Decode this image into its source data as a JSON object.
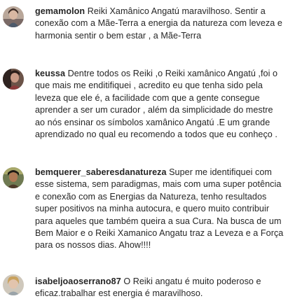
{
  "comments": [
    {
      "username": "gemamolon",
      "text": "Reiki Xamânico Angatú maravilhoso. Sentir a conexão com a Mãe-Terra a energia da natureza com leveza e harmonia sentir o bem estar , a Mãe-Terra"
    },
    {
      "username": "keussa",
      "text": "Dentre todos os Reiki ,o Reiki xamânico Angatú ,foi o que mais me enditifiquei , acredito eu que tenha sido pela leveza que ele é, a facilidade com que a gente consegue aprender a ser um curador , além da simplicidade do mestre ao nós ensinar os símbolos xamânico Angatú .E um grande aprendizado no qual eu recomendo a todos que eu conheço ."
    },
    {
      "username": "bemquerer_saberesdanatureza",
      "text": "Super me identifiquei com esse sistema, sem paradigmas, mais com uma super potência e conexão com as Energias da Natureza, tenho resultados super positivos na minha autocura, e quero muito contribuir para aqueles que também queira a sua Cura. Na busca de um Bem Maior e o Reiki Xamanico Angatu traz a Leveza e a Força para os nossos dias. Ahow!!!!"
    },
    {
      "username": "isabeljoaoserrano87",
      "text": "O Reiki angatu é muito poderoso e eficaz.trabalhar est energia é maravilhoso."
    }
  ]
}
